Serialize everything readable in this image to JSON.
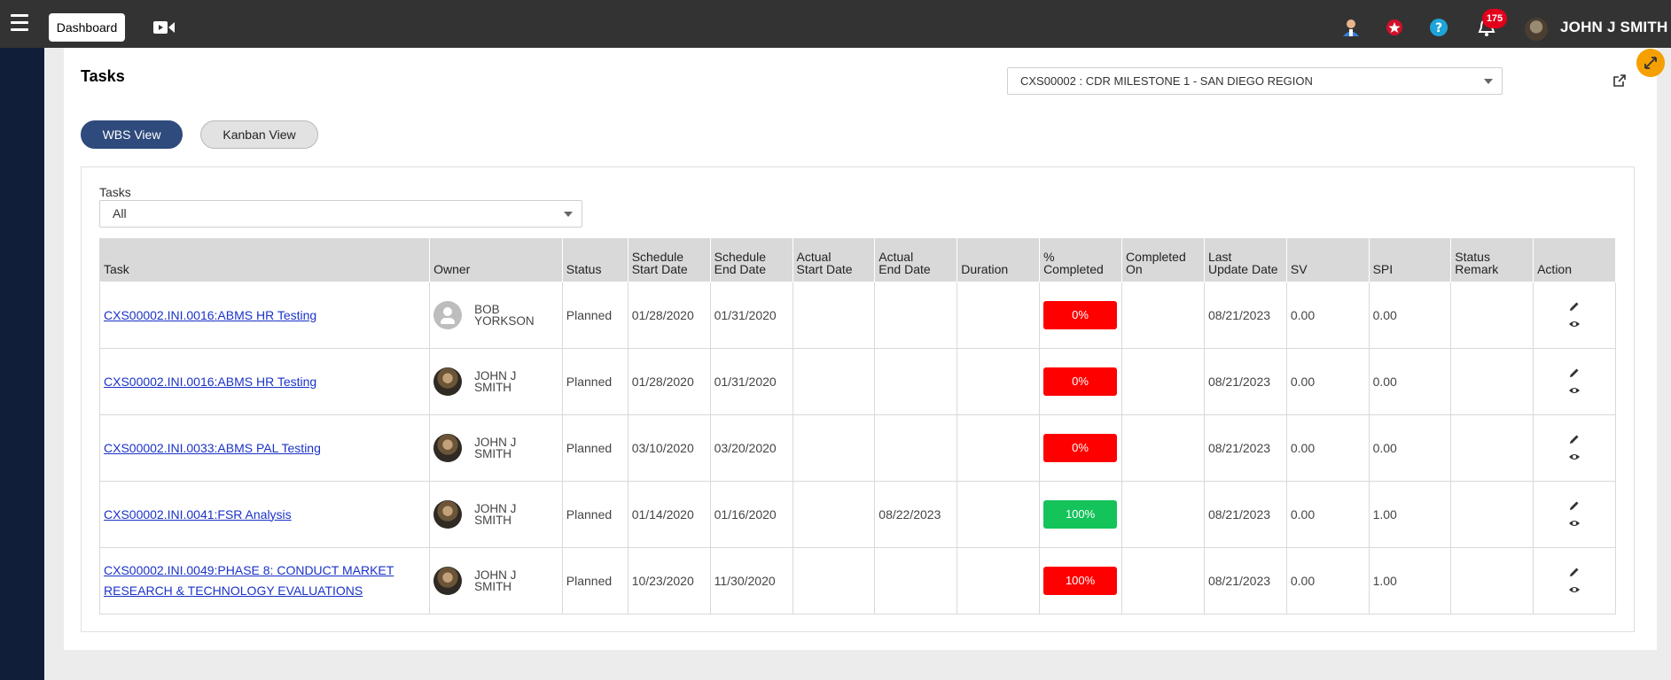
{
  "topbar": {
    "dashboard_label": "Dashboard",
    "notification_count": "175",
    "user_name": "JOHN J SMITH",
    "icons": [
      "menu-icon",
      "video-icon",
      "user-icon",
      "star-icon",
      "help-icon",
      "bell-icon"
    ]
  },
  "page": {
    "title": "Tasks",
    "project_selected": "CXS00002 : CDR MILESTONE 1 - SAN DIEGO REGION"
  },
  "views": {
    "wbs_label": "WBS View",
    "kanban_label": "Kanban View"
  },
  "filter": {
    "label": "Tasks",
    "value": "All"
  },
  "table": {
    "columns": [
      {
        "line1": "Task",
        "line2": ""
      },
      {
        "line1": "Owner",
        "line2": ""
      },
      {
        "line1": "Status",
        "line2": ""
      },
      {
        "line1": "Schedule",
        "line2": "Start Date"
      },
      {
        "line1": "Schedule",
        "line2": "End Date"
      },
      {
        "line1": "Actual",
        "line2": "Start Date"
      },
      {
        "line1": "Actual",
        "line2": "End Date"
      },
      {
        "line1": "Duration",
        "line2": ""
      },
      {
        "line1": "% Completed",
        "line2": ""
      },
      {
        "line1": "Completed",
        "line2": "On"
      },
      {
        "line1": "Last",
        "line2": "Update Date"
      },
      {
        "line1": "SV",
        "line2": ""
      },
      {
        "line1": "SPI",
        "line2": ""
      },
      {
        "line1": "Status",
        "line2": "Remark"
      },
      {
        "line1": "Action",
        "line2": ""
      }
    ],
    "rows": [
      {
        "task_line1": "CXS00002.INI.0016:ABMS HR Testing",
        "task_line2": "",
        "owner_line1": "BOB",
        "owner_line2": "YORKSON",
        "status": "Planned",
        "sched_start": "01/28/2020",
        "sched_end": "01/31/2020",
        "actual_start": "",
        "actual_end": "",
        "duration": "",
        "pct": "0%",
        "completed_on": "",
        "last_update": "08/21/2023",
        "sv": "0.00",
        "spi": "0.00",
        "remark": ""
      },
      {
        "task_line1": "CXS00002.INI.0016:ABMS HR Testing",
        "task_line2": "",
        "owner_line1": "JOHN J",
        "owner_line2": "SMITH",
        "status": "Planned",
        "sched_start": "01/28/2020",
        "sched_end": "01/31/2020",
        "actual_start": "",
        "actual_end": "",
        "duration": "",
        "pct": "0%",
        "completed_on": "",
        "last_update": "08/21/2023",
        "sv": "0.00",
        "spi": "0.00",
        "remark": ""
      },
      {
        "task_line1": "CXS00002.INI.0033:ABMS PAL Testing",
        "task_line2": "",
        "owner_line1": "JOHN J",
        "owner_line2": "SMITH",
        "status": "Planned",
        "sched_start": "03/10/2020",
        "sched_end": "03/20/2020",
        "actual_start": "",
        "actual_end": "",
        "duration": "",
        "pct": "0%",
        "completed_on": "",
        "last_update": "08/21/2023",
        "sv": "0.00",
        "spi": "0.00",
        "remark": ""
      },
      {
        "task_line1": "CXS00002.INI.0041:FSR Analysis",
        "task_line2": "",
        "owner_line1": "JOHN J",
        "owner_line2": "SMITH",
        "status": "Planned",
        "sched_start": "01/14/2020",
        "sched_end": "01/16/2020",
        "actual_start": "",
        "actual_end": "08/22/2023",
        "duration": "",
        "pct": "100%",
        "completed_on": "",
        "last_update": "08/21/2023",
        "sv": "0.00",
        "spi": "1.00",
        "remark": ""
      },
      {
        "task_line1": "CXS00002.INI.0049:PHASE 8: CONDUCT MARKET",
        "task_line2": "RESEARCH & TECHNOLOGY EVALUATIONS",
        "owner_line1": "JOHN J",
        "owner_line2": "SMITH",
        "status": "Planned",
        "sched_start": "10/23/2020",
        "sched_end": "11/30/2020",
        "actual_start": "",
        "actual_end": "",
        "duration": "",
        "pct": "100%",
        "completed_on": "",
        "last_update": "08/21/2023",
        "sv": "0.00",
        "spi": "1.00",
        "remark": ""
      }
    ]
  },
  "colors": {
    "topbar": "#333333",
    "leftnav": "#101e3a",
    "wbs_active": "#2f4a7c",
    "pct_red": "#ff0000",
    "pct_green": "#14c35a",
    "link": "#1a32c8",
    "badge": "#e3001b",
    "expand_button": "#f5a000"
  }
}
